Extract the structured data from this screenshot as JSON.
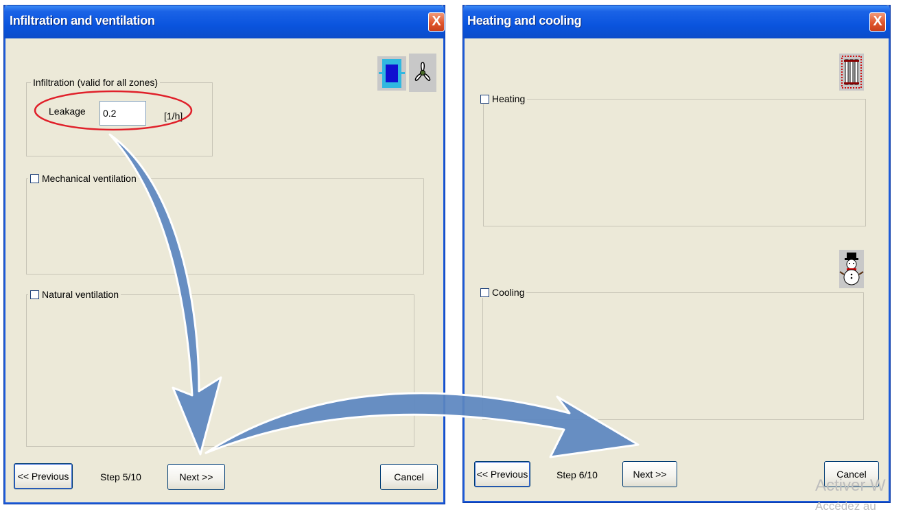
{
  "dialog1": {
    "title": "Infiltration and ventilation",
    "close": "X",
    "infiltration_label": "Infiltration (valid for all zones)",
    "leakage_label": "Leakage",
    "leakage_value": "0.2",
    "leakage_unit": "[1/h]",
    "mechanical_label": "Mechanical ventilation",
    "natural_label": "Natural ventilation",
    "previous_button": "<< Previous",
    "step": "Step 5/10",
    "next_button": "Next >>",
    "cancel_button": "Cancel"
  },
  "dialog2": {
    "title": "Heating and cooling",
    "close": "X",
    "heating_label": "Heating",
    "cooling_label": "Cooling",
    "previous_button": "<< Previous",
    "step": "Step 6/10",
    "next_button": "Next >>",
    "cancel_button": "Cancel"
  },
  "watermark": {
    "line1": "Activer W",
    "line2": "Accédez au"
  },
  "colors": {
    "titlebar": "#0a54de",
    "annotation_ellipse": "#e0202a",
    "arrow": "#5b86c0"
  }
}
